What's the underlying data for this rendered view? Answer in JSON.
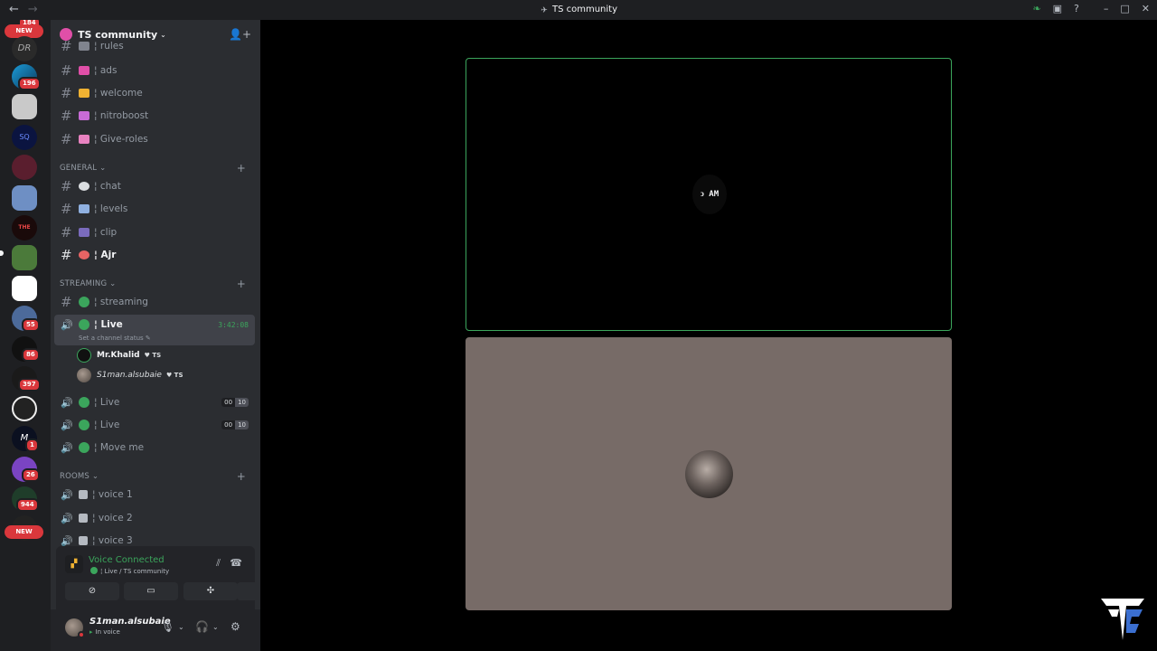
{
  "app": {
    "title": "TS community",
    "nav_back": "←",
    "nav_forward": "→"
  },
  "titlebar_icons": [
    "leaf-icon",
    "inbox-icon",
    "help-icon",
    "minimize-icon",
    "maximize-icon",
    "close-icon"
  ],
  "guild_badges": {
    "top": "184",
    "new_top": "NEW",
    "b196": "196",
    "b55": "55",
    "b86": "86",
    "b397": "397",
    "b1": "1",
    "b26": "26",
    "b944": "944",
    "new_bottom": "NEW"
  },
  "server": {
    "name": "TS community",
    "chevron": "⌄"
  },
  "channels_top": [
    {
      "label": "¦ rules",
      "color": "#80848e"
    },
    {
      "label": "¦ ads",
      "color": "#e04fa8"
    },
    {
      "label": "¦ welcome",
      "color": "#f0b232"
    },
    {
      "label": "¦ nitroboost",
      "color": "#c86bd6"
    },
    {
      "label": "¦ Give-roles",
      "color": "#e882c0"
    }
  ],
  "categories": {
    "general": "GENERAL ⌄",
    "streaming": "STREAMING ⌄",
    "rooms": "ROOMS ⌄",
    "plus": "+"
  },
  "general_channels": [
    {
      "label": "¦ chat",
      "color": "#dbdee1"
    },
    {
      "label": "¦ levels",
      "color": "#8fb0e0"
    },
    {
      "label": "¦ clip",
      "color": "#7a6bbd"
    },
    {
      "label": "¦ Ajr",
      "color": "#e86464"
    }
  ],
  "streaming": {
    "streaming_label": "¦ streaming",
    "live_label": "¦ Live",
    "live_timer": "3:42:08",
    "status": "Set a channel status ✎",
    "users": [
      {
        "name": "Mr.Khalid",
        "tag": "♥ TS"
      },
      {
        "name": "S1man.alsubaie",
        "tag": "♥ TS"
      }
    ],
    "live2_label": "¦ Live",
    "live2_counts": [
      "00",
      "10"
    ],
    "live3_label": "¦ Live",
    "live3_counts": [
      "00",
      "10"
    ],
    "moveme_label": "¦ Move me"
  },
  "rooms": [
    {
      "label": "¦ voice 1"
    },
    {
      "label": "¦ voice 2"
    },
    {
      "label": "¦ voice 3"
    }
  ],
  "voice_panel": {
    "title": "Voice Connected",
    "subtitle": "¦ Live / TS community",
    "buttons": [
      "camera-off-icon",
      "screen-share-icon",
      "activities-icon",
      "soundboard-icon"
    ]
  },
  "user_panel": {
    "name": "S1man.alsubaie",
    "status": "In voice"
  },
  "stage": {
    "tile1_avatar_text": "ↄ AM"
  }
}
